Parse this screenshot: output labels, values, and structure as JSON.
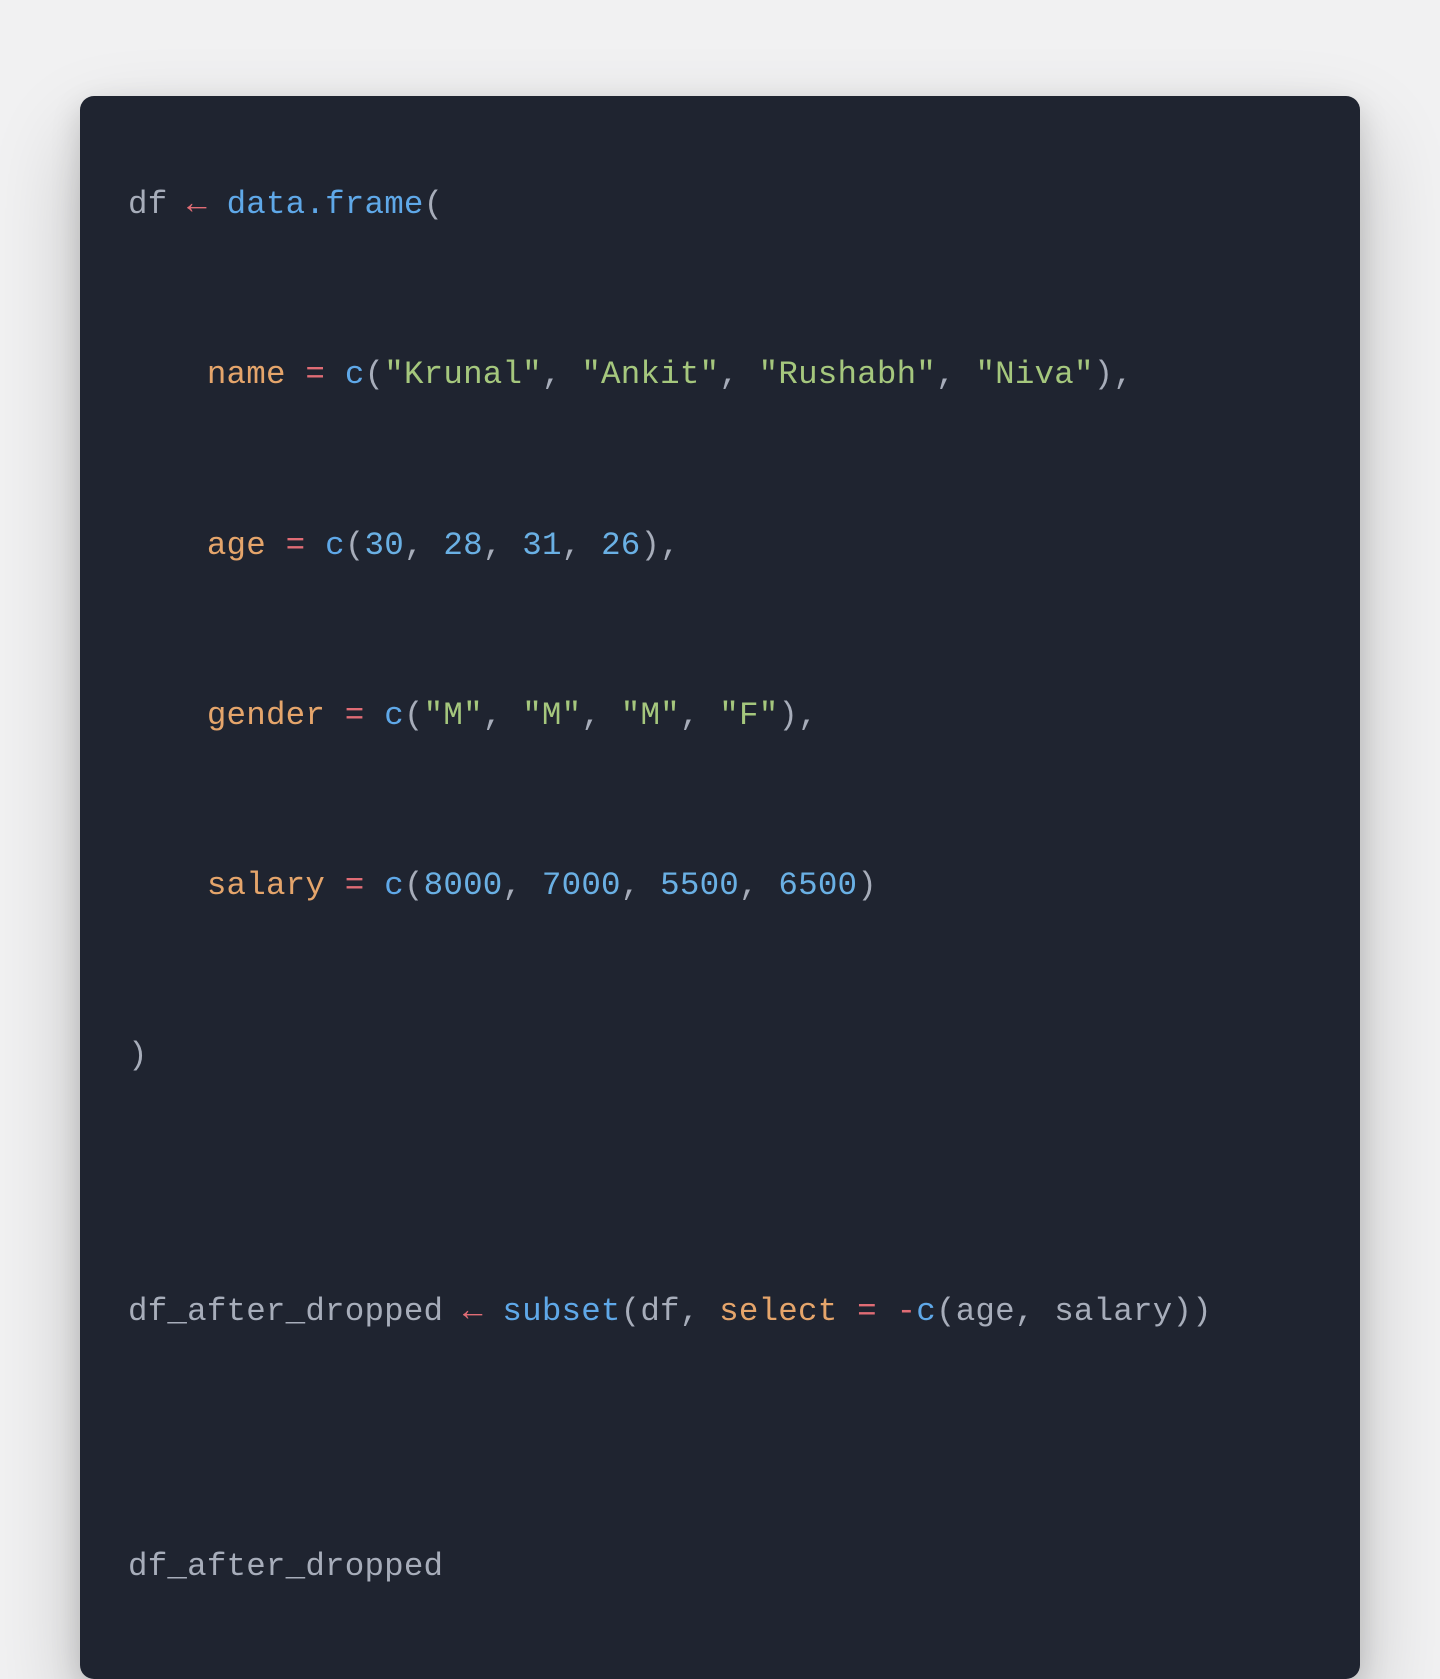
{
  "code": {
    "lines": [
      {
        "t": [
          {
            "c": "tok-var",
            "v": "df "
          },
          {
            "c": "tok-assign",
            "v": "←"
          },
          {
            "c": "tok-var",
            "v": " "
          },
          {
            "c": "tok-func",
            "v": "data.frame"
          },
          {
            "c": "tok-punc",
            "v": "("
          }
        ]
      },
      {
        "t": []
      },
      {
        "t": [
          {
            "c": "tok-var",
            "v": "    "
          },
          {
            "c": "tok-arg",
            "v": "name"
          },
          {
            "c": "tok-var",
            "v": " "
          },
          {
            "c": "tok-eq",
            "v": "="
          },
          {
            "c": "tok-var",
            "v": " "
          },
          {
            "c": "tok-func",
            "v": "c"
          },
          {
            "c": "tok-punc",
            "v": "("
          },
          {
            "c": "tok-str",
            "v": "\"Krunal\""
          },
          {
            "c": "tok-punc",
            "v": ", "
          },
          {
            "c": "tok-str",
            "v": "\"Ankit\""
          },
          {
            "c": "tok-punc",
            "v": ", "
          },
          {
            "c": "tok-str",
            "v": "\"Rushabh\""
          },
          {
            "c": "tok-punc",
            "v": ", "
          },
          {
            "c": "tok-str",
            "v": "\"Niva\""
          },
          {
            "c": "tok-punc",
            "v": "),"
          }
        ]
      },
      {
        "t": []
      },
      {
        "t": [
          {
            "c": "tok-var",
            "v": "    "
          },
          {
            "c": "tok-arg",
            "v": "age"
          },
          {
            "c": "tok-var",
            "v": " "
          },
          {
            "c": "tok-eq",
            "v": "="
          },
          {
            "c": "tok-var",
            "v": " "
          },
          {
            "c": "tok-func",
            "v": "c"
          },
          {
            "c": "tok-punc",
            "v": "("
          },
          {
            "c": "tok-num",
            "v": "30"
          },
          {
            "c": "tok-punc",
            "v": ", "
          },
          {
            "c": "tok-num",
            "v": "28"
          },
          {
            "c": "tok-punc",
            "v": ", "
          },
          {
            "c": "tok-num",
            "v": "31"
          },
          {
            "c": "tok-punc",
            "v": ", "
          },
          {
            "c": "tok-num",
            "v": "26"
          },
          {
            "c": "tok-punc",
            "v": "),"
          }
        ]
      },
      {
        "t": []
      },
      {
        "t": [
          {
            "c": "tok-var",
            "v": "    "
          },
          {
            "c": "tok-arg",
            "v": "gender"
          },
          {
            "c": "tok-var",
            "v": " "
          },
          {
            "c": "tok-eq",
            "v": "="
          },
          {
            "c": "tok-var",
            "v": " "
          },
          {
            "c": "tok-func",
            "v": "c"
          },
          {
            "c": "tok-punc",
            "v": "("
          },
          {
            "c": "tok-str",
            "v": "\"M\""
          },
          {
            "c": "tok-punc",
            "v": ", "
          },
          {
            "c": "tok-str",
            "v": "\"M\""
          },
          {
            "c": "tok-punc",
            "v": ", "
          },
          {
            "c": "tok-str",
            "v": "\"M\""
          },
          {
            "c": "tok-punc",
            "v": ", "
          },
          {
            "c": "tok-str",
            "v": "\"F\""
          },
          {
            "c": "tok-punc",
            "v": "),"
          }
        ]
      },
      {
        "t": []
      },
      {
        "t": [
          {
            "c": "tok-var",
            "v": "    "
          },
          {
            "c": "tok-arg",
            "v": "salary"
          },
          {
            "c": "tok-var",
            "v": " "
          },
          {
            "c": "tok-eq",
            "v": "="
          },
          {
            "c": "tok-var",
            "v": " "
          },
          {
            "c": "tok-func",
            "v": "c"
          },
          {
            "c": "tok-punc",
            "v": "("
          },
          {
            "c": "tok-num",
            "v": "8000"
          },
          {
            "c": "tok-punc",
            "v": ", "
          },
          {
            "c": "tok-num",
            "v": "7000"
          },
          {
            "c": "tok-punc",
            "v": ", "
          },
          {
            "c": "tok-num",
            "v": "5500"
          },
          {
            "c": "tok-punc",
            "v": ", "
          },
          {
            "c": "tok-num",
            "v": "6500"
          },
          {
            "c": "tok-punc",
            "v": ")"
          }
        ]
      },
      {
        "t": []
      },
      {
        "t": [
          {
            "c": "tok-punc",
            "v": ")"
          }
        ]
      },
      {
        "t": []
      },
      {
        "t": []
      },
      {
        "t": [
          {
            "c": "tok-var",
            "v": "df_after_dropped "
          },
          {
            "c": "tok-assign",
            "v": "←"
          },
          {
            "c": "tok-var",
            "v": " "
          },
          {
            "c": "tok-func",
            "v": "subset"
          },
          {
            "c": "tok-punc",
            "v": "(df, "
          },
          {
            "c": "tok-arg",
            "v": "select"
          },
          {
            "c": "tok-var",
            "v": " "
          },
          {
            "c": "tok-eq",
            "v": "="
          },
          {
            "c": "tok-var",
            "v": " "
          },
          {
            "c": "tok-minus",
            "v": "-"
          },
          {
            "c": "tok-func",
            "v": "c"
          },
          {
            "c": "tok-punc",
            "v": "(age, salary))"
          }
        ]
      },
      {
        "t": []
      },
      {
        "t": []
      },
      {
        "t": [
          {
            "c": "tok-var",
            "v": "df_after_dropped"
          }
        ]
      }
    ]
  }
}
